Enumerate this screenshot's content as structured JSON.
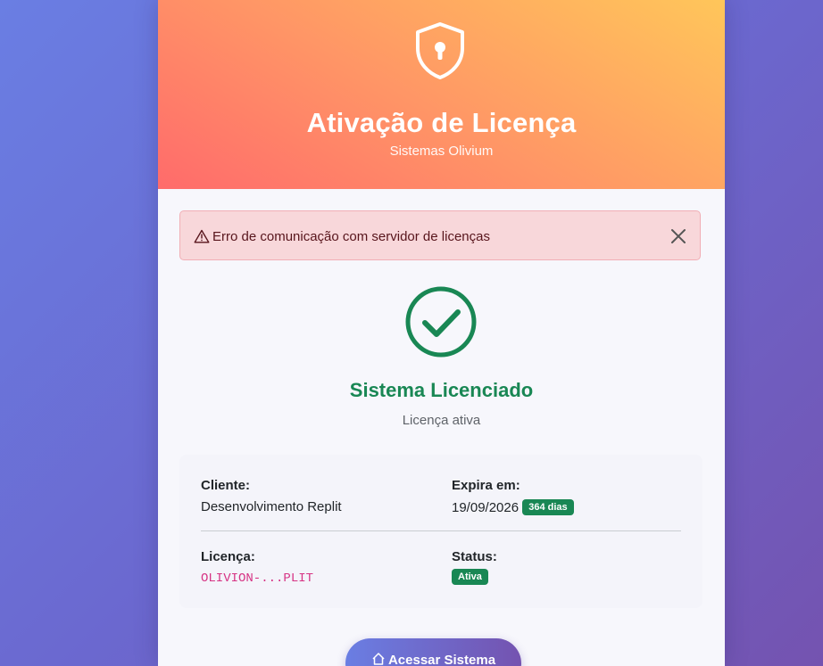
{
  "header": {
    "title": "Ativação de Licença",
    "subtitle": "Sistemas Olivium",
    "icon": "shield-lock-icon"
  },
  "alert": {
    "message": "Erro de comunicação com servidor de licenças",
    "icon": "warning-icon",
    "close_icon": "close-icon"
  },
  "status": {
    "icon": "check-circle-icon",
    "title": "Sistema Licenciado",
    "subtitle": "Licença ativa",
    "color": "#198754"
  },
  "details": {
    "cliente_label": "Cliente:",
    "cliente_value": "Desenvolvimento Replit",
    "expira_label": "Expira em:",
    "expira_value": "19/09/2026",
    "expira_badge": "364 dias",
    "licenca_label": "Licença:",
    "licenca_value": "OLIVION-...PLIT",
    "status_label": "Status:",
    "status_badge": "Ativa"
  },
  "actions": {
    "access_label": "Acessar Sistema",
    "access_icon": "home-icon"
  }
}
